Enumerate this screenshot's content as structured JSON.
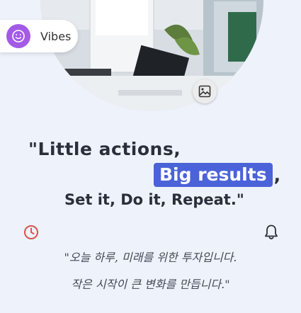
{
  "badge": {
    "label": "Vibes",
    "avatar_color": "#a35ae6"
  },
  "image": {
    "icon": "image-icon"
  },
  "quote": {
    "line1": "\"Little actions,",
    "highlight": "Big results",
    "comma": ",",
    "line3": "Set it, Do it, Repeat.\"",
    "highlight_color": "#4a63d8"
  },
  "korean": {
    "line1": "\"오늘 하루, 미래를 위한 투자입니다.",
    "line2": "작은 시작이 큰 변화를 만듭니다.\""
  },
  "icons": {
    "left": "clock-icon",
    "right": "bell-icon",
    "clock_color": "#d9534f"
  }
}
